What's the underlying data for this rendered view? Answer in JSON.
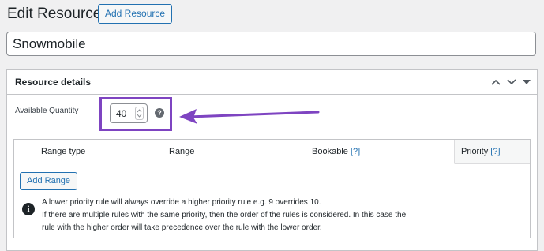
{
  "header": {
    "title": "Edit Resource",
    "add_button": "Add Resource"
  },
  "title_field": {
    "value": "Snowmobile"
  },
  "panel": {
    "title": "Resource details",
    "available_quantity_label": "Available Quantity",
    "available_quantity_value": "40",
    "help_glyph": "?",
    "icons": [
      "chevron-up-icon",
      "chevron-down-icon",
      "caret-down-icon",
      "help-icon",
      "arrow-annotation"
    ],
    "highlight_color": "#7e44c1"
  },
  "ranges": {
    "columns": {
      "range_type": "Range type",
      "range": "Range",
      "bookable": "Bookable",
      "priority": "Priority",
      "help_link": "[?]"
    },
    "add_range_label": "Add Range",
    "info_glyph": "i",
    "notes": [
      "A lower priority rule will always override a higher priority rule e.g. 9 overrides 10.",
      "If there are multiple rules with the same priority, then the order of the rules is considered. In this case the",
      "rule with the higher order will take precedence over the rule with the lower order."
    ]
  }
}
